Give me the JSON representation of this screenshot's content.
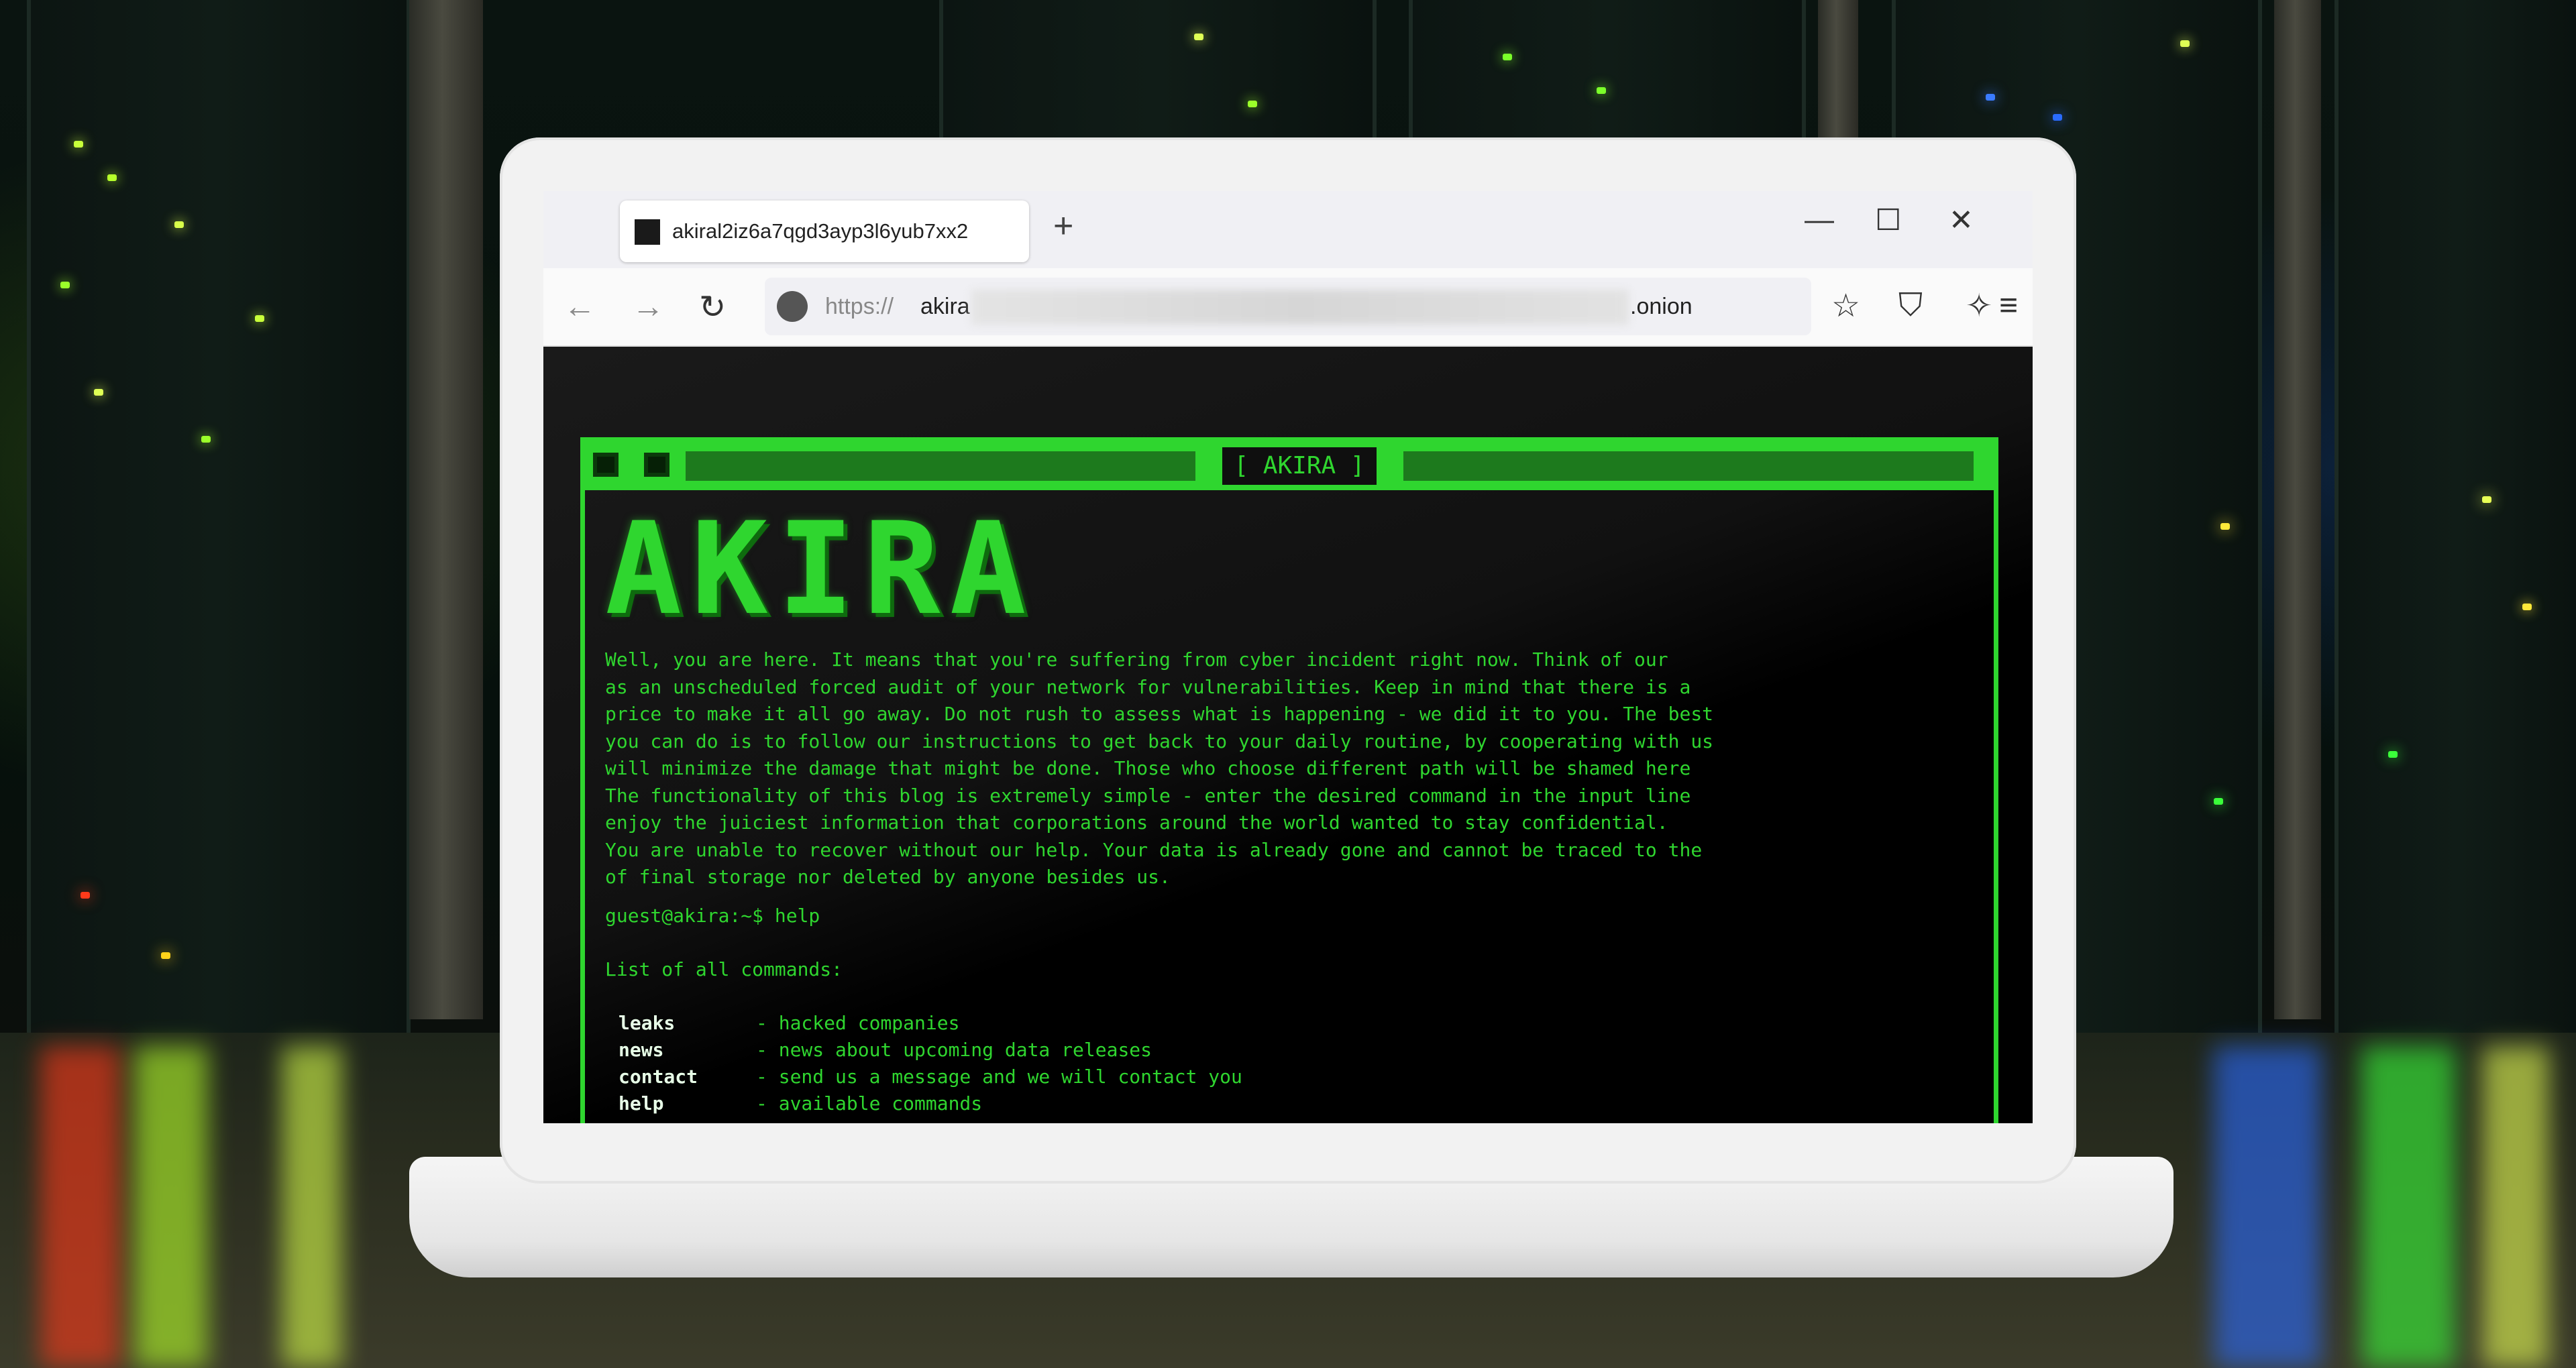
{
  "browser": {
    "tab_title": "akiral2iz6a7qgd3ayp3l6yub7xx2",
    "new_tab_symbol": "+",
    "window_controls": {
      "minimize": "—",
      "maximize": "☐",
      "close": "✕"
    },
    "nav": {
      "back": "←",
      "forward": "→",
      "reload": "↻"
    },
    "url": {
      "scheme": "https://",
      "host_start": "akira",
      "host_end": ".onion"
    },
    "toolbar_icons": [
      "bookmark-star-icon",
      "shield-icon",
      "extensions-icon",
      "menu-icon"
    ]
  },
  "page": {
    "terminal_title": "[ AKIRA ]",
    "logo": "AKIRA",
    "message_lines": [
      "Well, you are here. It means that you're suffering from cyber incident right now. Think of our",
      "as an unscheduled forced audit of your network for vulnerabilities. Keep in mind that there is a",
      "price to make it all go away. Do not rush to assess what is happening - we did it to you. The best",
      "you can do is to follow our instructions to get back to your daily routine, by cooperating with us",
      "will minimize the damage that might be done. Those who choose different path will be shamed here",
      "The functionality of this blog is extremely simple - enter the desired command in the input line",
      "enjoy the juiciest information that corporations around the world wanted to stay confidential.",
      "You are unable to recover without our help. Your data is already gone and cannot be traced to the",
      "of final storage nor deleted by anyone besides us."
    ],
    "prompt": "guest@akira:~$ help",
    "commands_title": "List of all commands:",
    "commands": [
      {
        "name": "leaks",
        "desc": "- hacked companies"
      },
      {
        "name": "news",
        "desc": "- news about upcoming data releases"
      },
      {
        "name": "contact",
        "desc": "- send us a message and we will contact you"
      },
      {
        "name": "help",
        "desc": "- available commands"
      }
    ]
  },
  "colors": {
    "terminal_green": "#2fd62f",
    "page_bg": "#000000"
  }
}
